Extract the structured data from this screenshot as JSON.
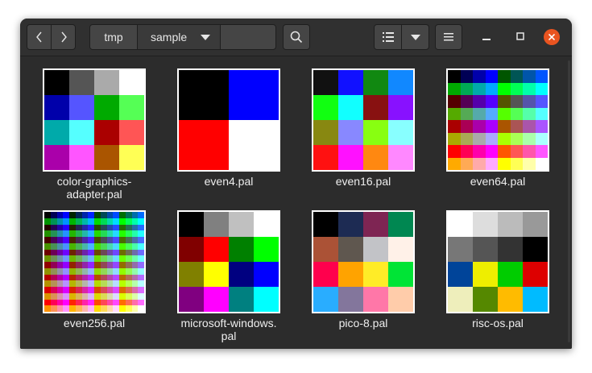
{
  "nav": {
    "back_icon": "chevron-left-icon",
    "forward_icon": "chevron-right-icon"
  },
  "breadcrumb": {
    "items": [
      "tmp",
      "sample"
    ]
  },
  "toolbar": {
    "search_icon": "search-icon",
    "view_icon": "list-view-icon",
    "view_menu_icon": "chevron-down-icon",
    "menu_icon": "hamburger-menu-icon"
  },
  "window_controls": {
    "minimize_icon": "minimize-icon",
    "maximize_icon": "maximize-icon",
    "close_icon": "close-icon",
    "close_color": "#e95420"
  },
  "files": [
    {
      "name": "color-graphics-\nadapter.pal",
      "cols": 4,
      "colors": [
        "#000000",
        "#555555",
        "#aaaaaa",
        "#ffffff",
        "#0000aa",
        "#5555ff",
        "#00aa00",
        "#55ff55",
        "#00aaaa",
        "#55ffff",
        "#aa0000",
        "#ff5555",
        "#aa00aa",
        "#ff55ff",
        "#aa5500",
        "#ffff55"
      ]
    },
    {
      "name": "even4.pal",
      "cols": 2,
      "colors": [
        "#000000",
        "#0000ff",
        "#ff0000",
        "#ffffff"
      ]
    },
    {
      "name": "even16.pal",
      "cols": 4,
      "colors": [
        "#111111",
        "#1111ff",
        "#118811",
        "#1188ff",
        "#11ff11",
        "#11ffff",
        "#881111",
        "#8811ff",
        "#888811",
        "#8888ff",
        "#88ff11",
        "#88ffff",
        "#ff1111",
        "#ff11ff",
        "#ff8811",
        "#ff88ff"
      ]
    },
    {
      "name": "even64.pal",
      "cols": 8,
      "colors": []
    },
    {
      "name": "even256.pal",
      "cols": 16,
      "colors": []
    },
    {
      "name": "microsoft-windows.\npal",
      "cols": 4,
      "colors": [
        "#000000",
        "#808080",
        "#c0c0c0",
        "#ffffff",
        "#800000",
        "#ff0000",
        "#008000",
        "#00ff00",
        "#808000",
        "#ffff00",
        "#000080",
        "#0000ff",
        "#800080",
        "#ff00ff",
        "#008080",
        "#00ffff"
      ]
    },
    {
      "name": "pico-8.pal",
      "cols": 4,
      "colors": [
        "#000000",
        "#1d2b53",
        "#7e2553",
        "#008751",
        "#ab5236",
        "#5f574f",
        "#c2c3c7",
        "#fff1e8",
        "#ff004d",
        "#ffa300",
        "#ffec27",
        "#00e436",
        "#29adff",
        "#83769c",
        "#ff77a8",
        "#ffccaa"
      ]
    },
    {
      "name": "risc-os.pal",
      "cols": 4,
      "colors": [
        "#ffffff",
        "#dddddd",
        "#bbbbbb",
        "#999999",
        "#777777",
        "#555555",
        "#333333",
        "#000000",
        "#004499",
        "#eeee00",
        "#00cc00",
        "#dd0000",
        "#eeeebb",
        "#558800",
        "#ffbb00",
        "#00bbff"
      ]
    }
  ]
}
